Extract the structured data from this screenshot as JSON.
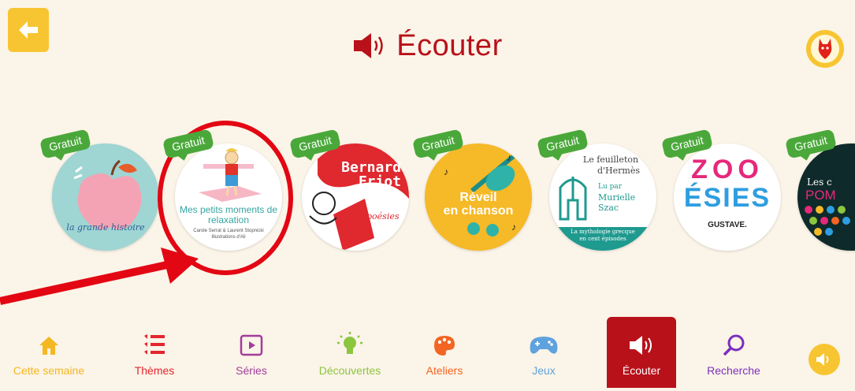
{
  "header": {
    "title": "Écouter"
  },
  "badge_label": "Gratuit",
  "cards": [
    {
      "text": "la grande histoire"
    },
    {
      "title": "Mes petits moments de relaxation",
      "authors": "Carole Serrat & Laurent Stopnicki",
      "illustrator": "Illustrations d'Ali"
    },
    {
      "name": "Bernard Friot",
      "sub": "poésies"
    },
    {
      "line1": "Réveil",
      "line2": "en chanson"
    },
    {
      "line1": "Le feuilleton",
      "line2": "d'Hermès",
      "lupar": "Lu par",
      "reader1": "Murielle",
      "reader2": "Szac",
      "tagline": "La mythologie grecque en cent épisodes"
    },
    {
      "word1": "ZOO",
      "word2": "ÉSIES",
      "author": "GUSTAVE."
    },
    {
      "line1": "Les c",
      "line2": "POM"
    }
  ],
  "nav": [
    {
      "label": "Cette semaine",
      "color": "#f5b722"
    },
    {
      "label": "Thèmes",
      "color": "#e3262e"
    },
    {
      "label": "Séries",
      "color": "#a23c9b"
    },
    {
      "label": "Découvertes",
      "color": "#8cc63f"
    },
    {
      "label": "Ateliers",
      "color": "#f26522"
    },
    {
      "label": "Jeux",
      "color": "#5fa2dd"
    },
    {
      "label": "Écouter",
      "color": "#ffffff"
    },
    {
      "label": "Recherche",
      "color": "#7b2fbf"
    }
  ],
  "colors": {
    "accent": "#b8111a",
    "yellow": "#f7c531",
    "badge": "#4aa83a",
    "highlight": "#e30613"
  }
}
